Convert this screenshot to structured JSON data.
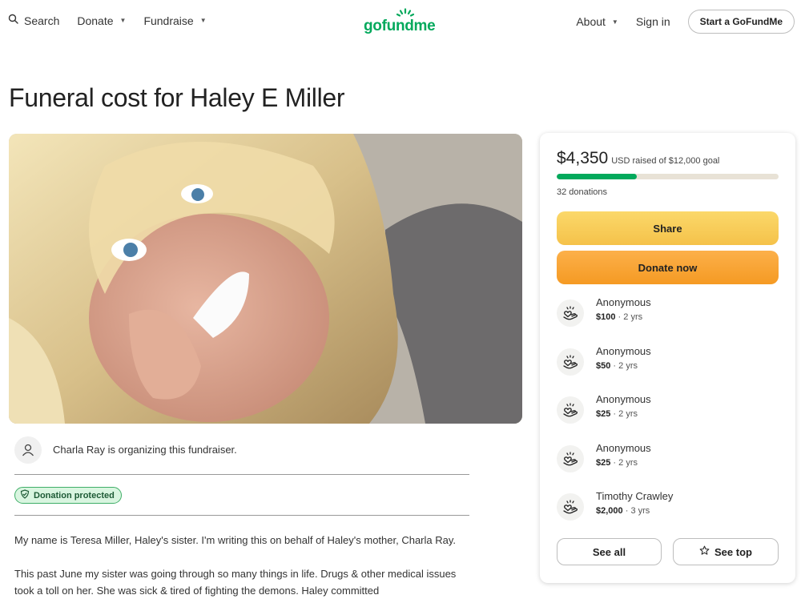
{
  "header": {
    "search_label": "Search",
    "donate_label": "Donate",
    "fundraise_label": "Fundraise",
    "logo_text": "gofundme",
    "about_label": "About",
    "signin_label": "Sign in",
    "start_label": "Start a GoFundMe"
  },
  "campaign": {
    "title": "Funeral cost for Haley E Miller",
    "organizer_text": "Charla Ray is organizing this fundraiser.",
    "protected_label": "Donation protected",
    "story": [
      "My name is Teresa Miller, Haley's sister. I'm writing this on behalf of Haley's mother, Charla Ray.",
      "This past June my sister was going through so many things in life. Drugs & other medical issues took a toll on her. She was sick & tired of fighting the demons. Haley committed"
    ]
  },
  "donation": {
    "amount": "$4,350",
    "raised_text": "USD raised of $12,000 goal",
    "progress_fraction": 0.3625,
    "count_text": "32 donations",
    "share_label": "Share",
    "donate_label": "Donate now",
    "donors": [
      {
        "name": "Anonymous",
        "amount": "$100",
        "time": "2 yrs"
      },
      {
        "name": "Anonymous",
        "amount": "$50",
        "time": "2 yrs"
      },
      {
        "name": "Anonymous",
        "amount": "$25",
        "time": "2 yrs"
      },
      {
        "name": "Anonymous",
        "amount": "$25",
        "time": "2 yrs"
      },
      {
        "name": "Timothy Crawley",
        "amount": "$2,000",
        "time": "3 yrs"
      }
    ],
    "see_all_label": "See all",
    "see_top_label": "See top"
  },
  "colors": {
    "brand_green": "#02a95c",
    "share_yellow": "#f8cd5a",
    "donate_orange": "#f7a531"
  }
}
